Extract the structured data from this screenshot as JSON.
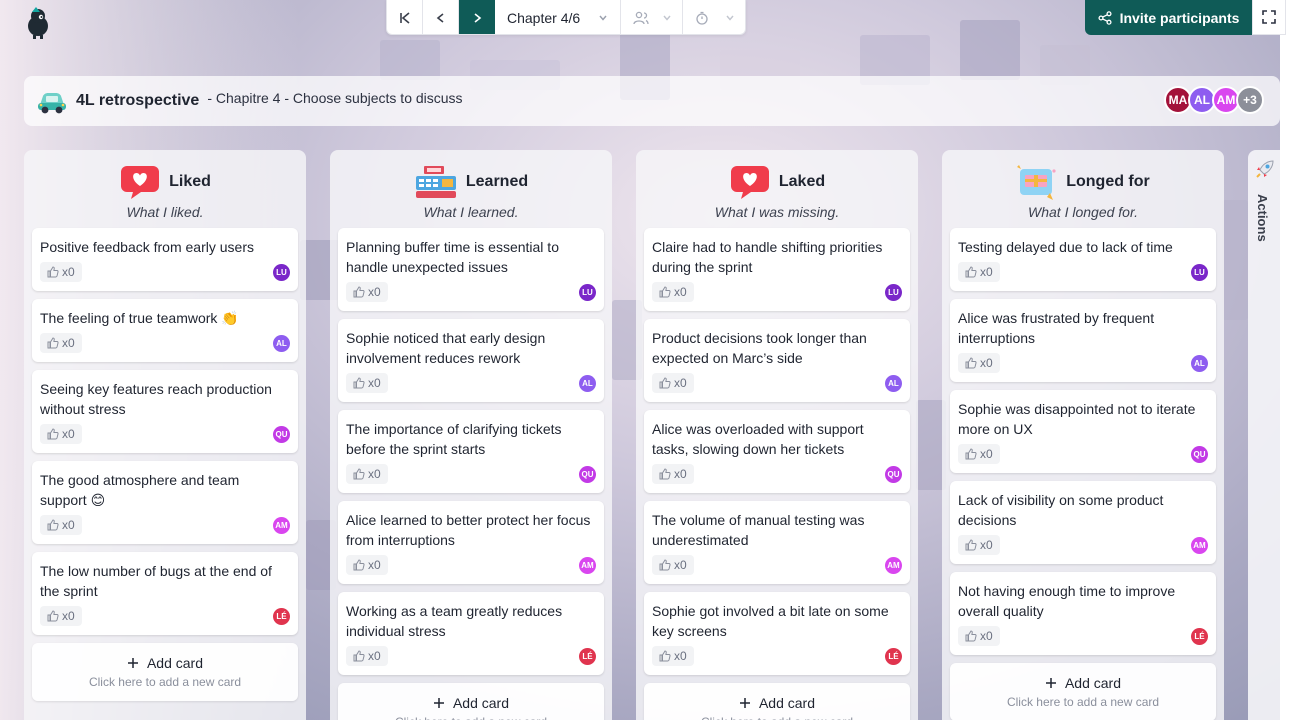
{
  "toolbar": {
    "chapter": "Chapter 4/6",
    "invite_label": "Invite participants"
  },
  "header": {
    "title": "4L retrospective",
    "subtitle": "- Chapitre 4 - Choose subjects to discuss",
    "avatars": [
      {
        "initials": "MA",
        "color": "#a3123a"
      },
      {
        "initials": "AL",
        "color": "#8e5df0"
      },
      {
        "initials": "AM",
        "color": "#d946ef"
      },
      {
        "initials": "+3",
        "color": "#8c8f99"
      }
    ]
  },
  "columns": [
    {
      "title": "Liked",
      "subtitle": "What I liked.",
      "cards": [
        {
          "text": "Positive feedback from early users",
          "likes": "x0",
          "author": "LU",
          "color": "#7a27c9"
        },
        {
          "text": "The feeling of true teamwork 👏",
          "likes": "x0",
          "author": "AL",
          "color": "#8e5df0"
        },
        {
          "text": "Seeing key features reach production without stress",
          "likes": "x0",
          "author": "QU",
          "color": "#c23ae6"
        },
        {
          "text": "The good atmosphere and team support 😊",
          "likes": "x0",
          "author": "AM",
          "color": "#d946ef"
        },
        {
          "text": "The low number of bugs at the end of the sprint",
          "likes": "x0",
          "author": "LÉ",
          "color": "#e0344e"
        }
      ],
      "add_label": "Add card",
      "add_hint": "Click here to add a new card"
    },
    {
      "title": "Learned",
      "subtitle": "What I learned.",
      "cards": [
        {
          "text": "Planning buffer time is essential to handle unexpected issues",
          "likes": "x0",
          "author": "LU",
          "color": "#7a27c9"
        },
        {
          "text": "Sophie noticed that early design involvement reduces rework",
          "likes": "x0",
          "author": "AL",
          "color": "#8e5df0"
        },
        {
          "text": "The importance of clarifying tickets before the sprint starts",
          "likes": "x0",
          "author": "QU",
          "color": "#c23ae6"
        },
        {
          "text": "Alice learned to better protect her focus from interruptions",
          "likes": "x0",
          "author": "AM",
          "color": "#d946ef"
        },
        {
          "text": "Working as a team greatly reduces individual stress",
          "likes": "x0",
          "author": "LÉ",
          "color": "#e0344e"
        }
      ],
      "add_label": "Add card",
      "add_hint": "Click here to add a new card"
    },
    {
      "title": "Laked",
      "subtitle": "What I was missing.",
      "cards": [
        {
          "text": "Claire had to handle shifting priorities during the sprint",
          "likes": "x0",
          "author": "LU",
          "color": "#7a27c9"
        },
        {
          "text": "Product decisions took longer than expected on Marc’s side",
          "likes": "x0",
          "author": "AL",
          "color": "#8e5df0"
        },
        {
          "text": "Alice was overloaded with support tasks, slowing down her tickets",
          "likes": "x0",
          "author": "QU",
          "color": "#c23ae6"
        },
        {
          "text": "The volume of manual testing was underestimated",
          "likes": "x0",
          "author": "AM",
          "color": "#d946ef"
        },
        {
          "text": "Sophie got involved a bit late on some key screens",
          "likes": "x0",
          "author": "LÉ",
          "color": "#e0344e"
        }
      ],
      "add_label": "Add card",
      "add_hint": "Click here to add a new card"
    },
    {
      "title": "Longed for",
      "subtitle": "What I longed for.",
      "cards": [
        {
          "text": "Testing delayed due to lack of time",
          "likes": "x0",
          "author": "LU",
          "color": "#7a27c9"
        },
        {
          "text": "Alice was frustrated by frequent interruptions",
          "likes": "x0",
          "author": "AL",
          "color": "#8e5df0"
        },
        {
          "text": "Sophie was disappointed not to iterate more on UX",
          "likes": "x0",
          "author": "QU",
          "color": "#c23ae6"
        },
        {
          "text": "Lack of visibility on some product decisions",
          "likes": "x0",
          "author": "AM",
          "color": "#d946ef"
        },
        {
          "text": "Not having enough time to improve overall quality",
          "likes": "x0",
          "author": "LÉ",
          "color": "#e0344e"
        }
      ],
      "add_label": "Add card",
      "add_hint": "Click here to add a new card"
    }
  ],
  "actions_label": "Actions",
  "colors": {
    "accent": "#0f5b57"
  }
}
